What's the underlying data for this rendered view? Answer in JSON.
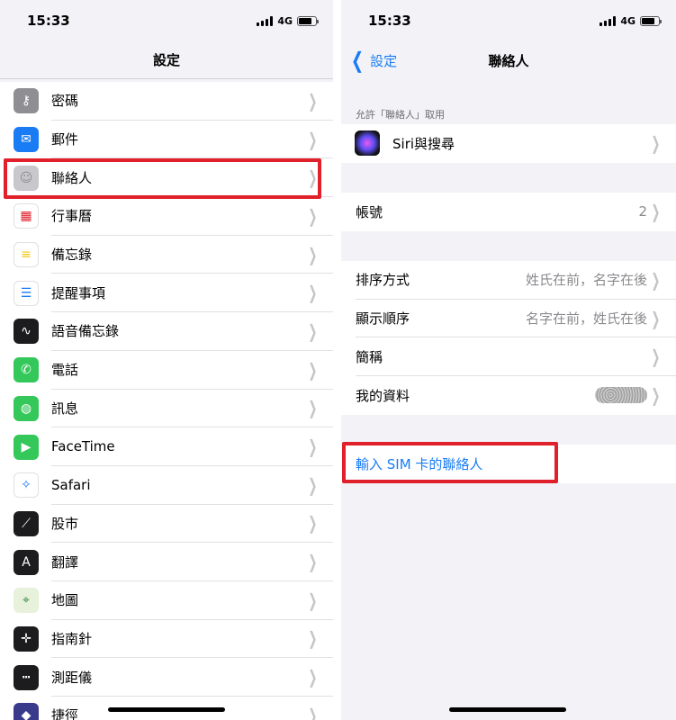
{
  "status": {
    "time": "15:33",
    "network": "4G"
  },
  "left": {
    "title": "設定",
    "items": [
      {
        "label": "密碼",
        "icon": "key-icon",
        "color": "#8e8e93"
      },
      {
        "label": "郵件",
        "icon": "mail-icon",
        "color": "#1a7cf4"
      },
      {
        "label": "聯絡人",
        "icon": "contacts-icon",
        "color": "#c7c7cc"
      },
      {
        "label": "行事曆",
        "icon": "calendar-icon",
        "color": "#ffffff"
      },
      {
        "label": "備忘錄",
        "icon": "notes-icon",
        "color": "#ffffff"
      },
      {
        "label": "提醒事項",
        "icon": "reminders-icon",
        "color": "#ffffff"
      },
      {
        "label": "語音備忘錄",
        "icon": "voice-memos-icon",
        "color": "#1c1c1e"
      },
      {
        "label": "電話",
        "icon": "phone-icon",
        "color": "#34c759"
      },
      {
        "label": "訊息",
        "icon": "messages-icon",
        "color": "#34c759"
      },
      {
        "label": "FaceTime",
        "icon": "facetime-icon",
        "color": "#34c759"
      },
      {
        "label": "Safari",
        "icon": "safari-icon",
        "color": "#ffffff"
      },
      {
        "label": "股市",
        "icon": "stocks-icon",
        "color": "#1c1c1e"
      },
      {
        "label": "翻譯",
        "icon": "translate-icon",
        "color": "#1c1c1e"
      },
      {
        "label": "地圖",
        "icon": "maps-icon",
        "color": "#e7f1dc"
      },
      {
        "label": "指南針",
        "icon": "compass-icon",
        "color": "#1c1c1e"
      },
      {
        "label": "測距儀",
        "icon": "measure-icon",
        "color": "#1c1c1e"
      },
      {
        "label": "捷徑",
        "icon": "shortcuts-icon",
        "color": "#3a3a8c"
      }
    ]
  },
  "right": {
    "back_label": "設定",
    "title": "聯絡人",
    "section_header": "允許「聯絡人」取用",
    "siri_label": "Siri與搜尋",
    "accounts_label": "帳號",
    "accounts_value": "2",
    "sort_label": "排序方式",
    "sort_value": "姓氏在前，名字在後",
    "display_label": "顯示順序",
    "display_value": "名字在前，姓氏在後",
    "short_label": "簡稱",
    "my_info_label": "我的資料",
    "import_sim_label": "輸入 SIM 卡的聯絡人"
  },
  "colors": {
    "highlight": "#e0202a",
    "accent": "#1a7cf4"
  }
}
